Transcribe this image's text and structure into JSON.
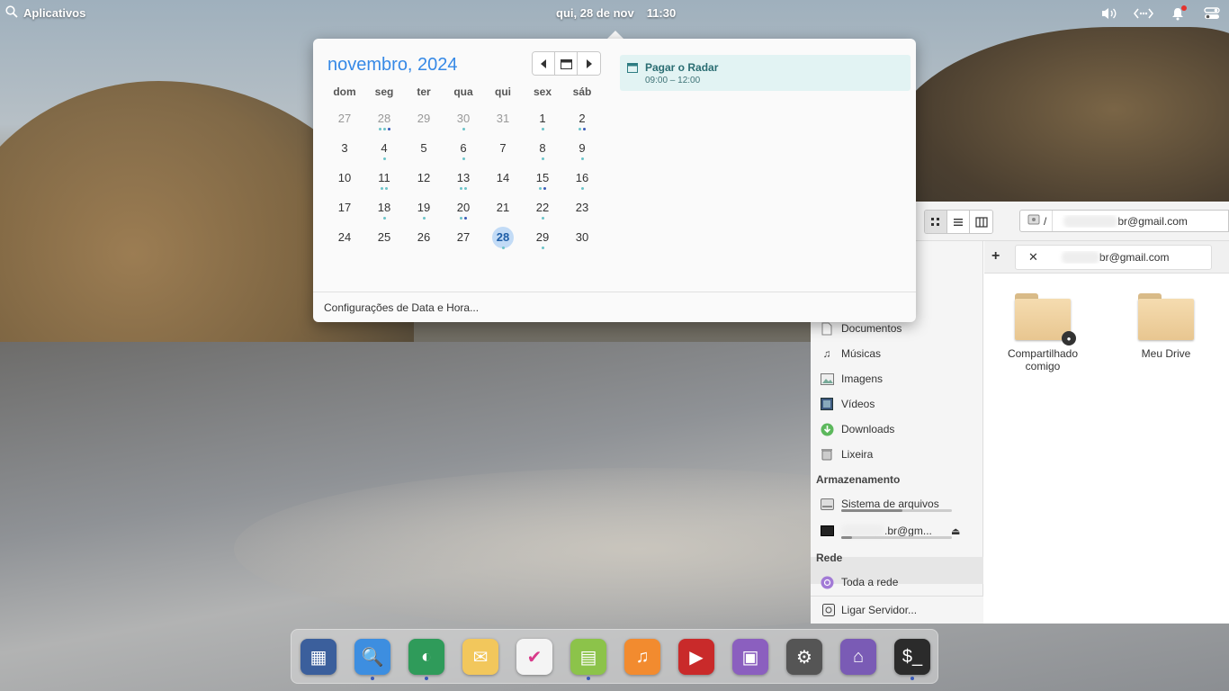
{
  "panel": {
    "apps_label": "Aplicativos",
    "date": "qui, 28 de nov",
    "time": "11:30",
    "indicators": [
      "volume-icon",
      "network-icon",
      "notifications-icon",
      "settings-toggle-icon"
    ]
  },
  "calendar": {
    "month_title": "novembro, 2024",
    "weekdays": [
      "dom",
      "seg",
      "ter",
      "qua",
      "qui",
      "sex",
      "sáb"
    ],
    "days": [
      {
        "n": "27",
        "other": true,
        "dots": ""
      },
      {
        "n": "28",
        "other": true,
        "dots": "ggb"
      },
      {
        "n": "29",
        "other": true,
        "dots": ""
      },
      {
        "n": "30",
        "other": true,
        "dots": "g"
      },
      {
        "n": "31",
        "other": true,
        "dots": ""
      },
      {
        "n": "1",
        "dots": "g"
      },
      {
        "n": "2",
        "dots": "gb"
      },
      {
        "n": "3",
        "dots": ""
      },
      {
        "n": "4",
        "dots": "g"
      },
      {
        "n": "5",
        "dots": ""
      },
      {
        "n": "6",
        "dots": "g"
      },
      {
        "n": "7",
        "dots": ""
      },
      {
        "n": "8",
        "dots": "g"
      },
      {
        "n": "9",
        "dots": "g"
      },
      {
        "n": "10",
        "dots": ""
      },
      {
        "n": "11",
        "dots": "gg"
      },
      {
        "n": "12",
        "dots": ""
      },
      {
        "n": "13",
        "dots": "gg"
      },
      {
        "n": "14",
        "dots": ""
      },
      {
        "n": "15",
        "dots": "gb"
      },
      {
        "n": "16",
        "dots": "g"
      },
      {
        "n": "17",
        "dots": ""
      },
      {
        "n": "18",
        "dots": "g"
      },
      {
        "n": "19",
        "dots": "g"
      },
      {
        "n": "20",
        "dots": "gb"
      },
      {
        "n": "21",
        "dots": ""
      },
      {
        "n": "22",
        "dots": "g"
      },
      {
        "n": "23",
        "dots": ""
      },
      {
        "n": "24",
        "dots": ""
      },
      {
        "n": "25",
        "dots": ""
      },
      {
        "n": "26",
        "dots": ""
      },
      {
        "n": "27",
        "dots": ""
      },
      {
        "n": "28",
        "today": true,
        "dots": "g"
      },
      {
        "n": "29",
        "dots": "g"
      },
      {
        "n": "30",
        "dots": ""
      }
    ],
    "event": {
      "title": "Pagar o Radar",
      "time": "09:00 – 12:00"
    },
    "footer": "Configurações de Data e Hora..."
  },
  "file_manager": {
    "path_root": "/",
    "path_account": "br@gmail.com",
    "tab_label": "br@gmail.com",
    "sidebar": {
      "places": [
        {
          "label": "Documentos",
          "icon": "document-icon"
        },
        {
          "label": "Músicas",
          "icon": "music-icon"
        },
        {
          "label": "Imagens",
          "icon": "image-icon"
        },
        {
          "label": "Vídeos",
          "icon": "video-icon"
        },
        {
          "label": "Downloads",
          "icon": "download-icon"
        },
        {
          "label": "Lixeira",
          "icon": "trash-icon"
        }
      ],
      "storage_heading": "Armazenamento",
      "filesystem_label": "Sistema de arquivos",
      "drive_label": ".br@gm...",
      "network_heading": "Rede",
      "network_label": "Toda a rede",
      "connect_label": "Ligar Servidor..."
    },
    "folders": [
      {
        "label": "Compartilhado comigo",
        "shared": true
      },
      {
        "label": "Meu Drive",
        "shared": false
      }
    ]
  },
  "dock": {
    "apps": [
      {
        "name": "multitasking-view",
        "color": "#3b5f9c",
        "glyph": "▦",
        "running": false
      },
      {
        "name": "files",
        "color": "#3d8ee0",
        "glyph": "🔍",
        "running": true
      },
      {
        "name": "web-browser",
        "color": "#2f9b5a",
        "glyph": "◐",
        "running": true
      },
      {
        "name": "mail",
        "color": "#f2c75c",
        "glyph": "✉",
        "running": false
      },
      {
        "name": "tasks",
        "color": "#f4f4f4",
        "glyph": "✔",
        "running": false
      },
      {
        "name": "calendar",
        "color": "#8cc34a",
        "glyph": "▤",
        "running": true
      },
      {
        "name": "music",
        "color": "#f28b2f",
        "glyph": "♫",
        "running": false
      },
      {
        "name": "videos",
        "color": "#c92a2a",
        "glyph": "▶",
        "running": false
      },
      {
        "name": "photos",
        "color": "#8b5fbf",
        "glyph": "▣",
        "running": false
      },
      {
        "name": "system-settings",
        "color": "#555555",
        "glyph": "⚙",
        "running": false
      },
      {
        "name": "app-center",
        "color": "#7a5bb5",
        "glyph": "⌂",
        "running": false
      },
      {
        "name": "terminal",
        "color": "#2b2b2b",
        "glyph": "$_",
        "running": true
      }
    ]
  }
}
